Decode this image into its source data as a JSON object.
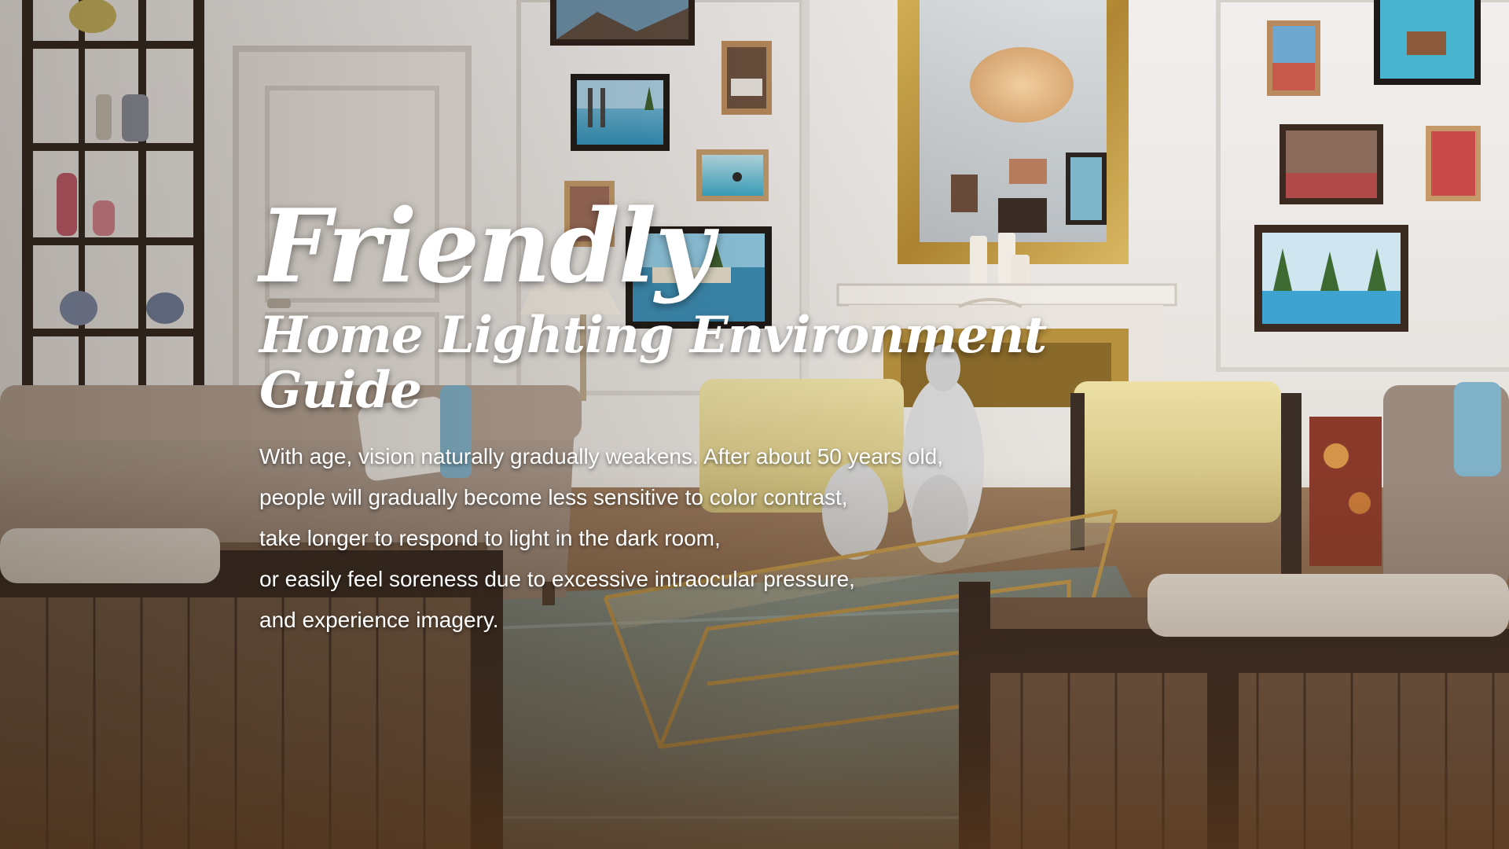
{
  "hero": {
    "headline": "Friendly",
    "subheadline": "Home Lighting Environment Guide",
    "body_lines": [
      "With age, vision naturally gradually weakens. After about 50 years old,",
      "people will gradually become less sensitive to color contrast,",
      "take longer to respond to light in the dark room,",
      "or easily feel soreness due to excessive intraocular pressure,",
      "and experience imagery."
    ]
  },
  "colors": {
    "text": "#ffffff",
    "wall": "#ece9e6",
    "mirror_frame": "#c29a3a",
    "armchair": "#e6d89a",
    "sofa": "#a8968a",
    "floor_shadow": "#5a3a22"
  }
}
